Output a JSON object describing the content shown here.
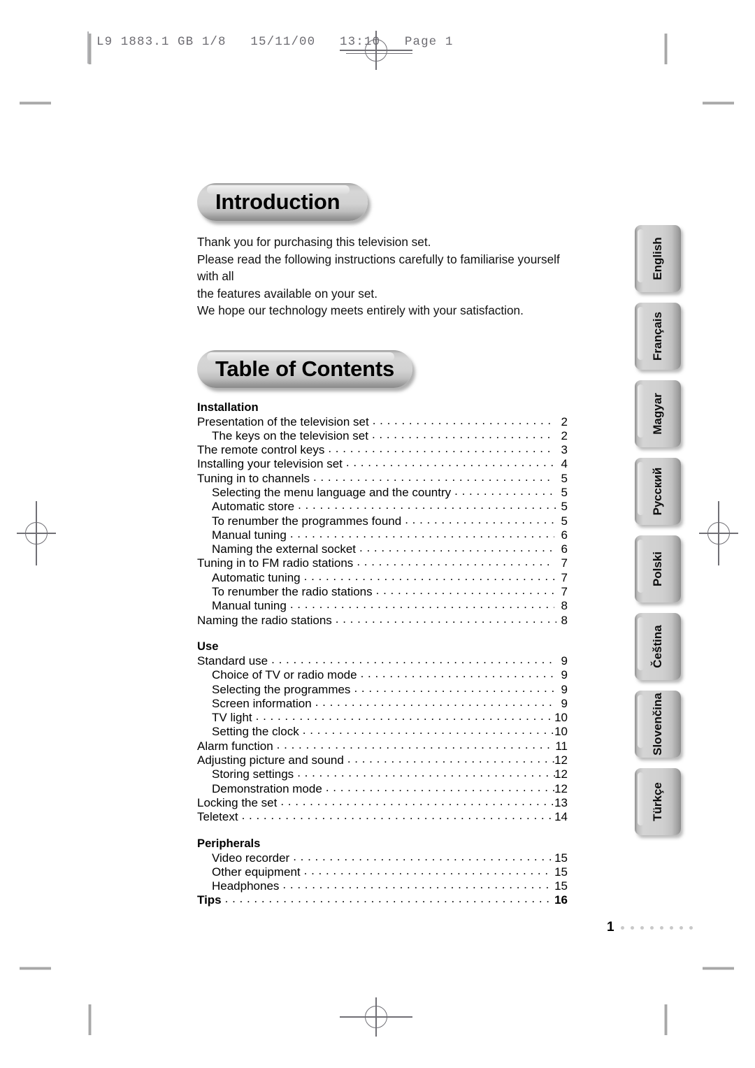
{
  "print_header": {
    "text": "L9 1883.1 GB 1/8   15/11/00   13:10   Page 1"
  },
  "banners": {
    "introduction": "Introduction",
    "table_of_contents": "Table of Contents"
  },
  "intro": {
    "lines": [
      "Thank you for purchasing this television set.",
      "Please read the following instructions carefully to familiarise yourself with all",
      "the features available on your set.",
      "We hope our technology meets entirely with your satisfaction."
    ]
  },
  "toc": {
    "sections": [
      {
        "title": "Installation",
        "entries": [
          {
            "label": "Presentation of the television set",
            "page": "2",
            "level": 1,
            "bold": false,
            "tight": false
          },
          {
            "label": "The keys on the television set",
            "page": "2",
            "level": 2,
            "bold": false,
            "tight": false
          },
          {
            "label": "The remote control keys",
            "page": "3",
            "level": 1,
            "bold": false,
            "tight": false
          },
          {
            "label": "Installing your television set",
            "page": "4",
            "level": 1,
            "bold": false,
            "tight": false
          },
          {
            "label": "Tuning in to channels",
            "page": "5",
            "level": 1,
            "bold": false,
            "tight": false
          },
          {
            "label": "Selecting the menu language and the country",
            "page": "5",
            "level": 2,
            "bold": false,
            "tight": true
          },
          {
            "label": "Automatic store",
            "page": "5",
            "level": 2,
            "bold": false,
            "tight": true
          },
          {
            "label": "To renumber the programmes found",
            "page": "5",
            "level": 2,
            "bold": false,
            "tight": false
          },
          {
            "label": "Manual tuning",
            "page": "6",
            "level": 2,
            "bold": false,
            "tight": false
          },
          {
            "label": "Naming the external socket",
            "page": "6",
            "level": 2,
            "bold": false,
            "tight": false
          },
          {
            "label": "Tuning in to FM radio stations",
            "page": "7",
            "level": 1,
            "bold": false,
            "tight": false
          },
          {
            "label": "Automatic tuning",
            "page": "7",
            "level": 2,
            "bold": false,
            "tight": true
          },
          {
            "label": "To renumber the radio stations",
            "page": "7",
            "level": 2,
            "bold": false,
            "tight": false
          },
          {
            "label": "Manual tuning",
            "page": "8",
            "level": 2,
            "bold": false,
            "tight": false
          },
          {
            "label": "Naming the radio stations",
            "page": "8",
            "level": 1,
            "bold": false,
            "tight": true
          }
        ]
      },
      {
        "title": "Use",
        "entries": [
          {
            "label": "Standard use",
            "page": "9",
            "level": 1,
            "bold": false,
            "tight": false
          },
          {
            "label": "Choice of TV or radio mode",
            "page": "9",
            "level": 2,
            "bold": false,
            "tight": true
          },
          {
            "label": "Selecting the programmes",
            "page": "9",
            "level": 2,
            "bold": false,
            "tight": true
          },
          {
            "label": "Screen information",
            "page": "9",
            "level": 2,
            "bold": false,
            "tight": true
          },
          {
            "label": "TV light",
            "page": "10",
            "level": 2,
            "bold": false,
            "tight": true
          },
          {
            "label": "Setting the clock",
            "page": "10",
            "level": 2,
            "bold": false,
            "tight": true
          },
          {
            "label": "Alarm function",
            "page": "11",
            "level": 1,
            "bold": false,
            "tight": false
          },
          {
            "label": "Adjusting picture and sound",
            "page": "12",
            "level": 1,
            "bold": false,
            "tight": true
          },
          {
            "label": "Storing settings",
            "page": "12",
            "level": 2,
            "bold": false,
            "tight": true
          },
          {
            "label": "Demonstration mode",
            "page": "12",
            "level": 2,
            "bold": false,
            "tight": true
          },
          {
            "label": "Locking the set",
            "page": "13",
            "level": 1,
            "bold": false,
            "tight": true
          },
          {
            "label": "Teletext",
            "page": "14",
            "level": 1,
            "bold": false,
            "tight": false
          }
        ]
      },
      {
        "title": "Peripherals",
        "entries": [
          {
            "label": "Video recorder",
            "page": "15",
            "level": 2,
            "bold": false,
            "tight": false
          },
          {
            "label": "Other equipment",
            "page": "15",
            "level": 2,
            "bold": false,
            "tight": false
          },
          {
            "label": "Headphones",
            "page": "15",
            "level": 2,
            "bold": false,
            "tight": false
          },
          {
            "label": "Tips",
            "page": "16",
            "level": 1,
            "bold": true,
            "tight": false
          }
        ]
      }
    ]
  },
  "language_tabs": [
    {
      "label": "English"
    },
    {
      "label": "Français"
    },
    {
      "label": "Magyar"
    },
    {
      "label": "Русский"
    },
    {
      "label": "Polski"
    },
    {
      "label": "Čeština"
    },
    {
      "label": "Slovenčina"
    },
    {
      "label": "Türkçe"
    }
  ],
  "footer": {
    "page_number": "1",
    "dot_count": 8
  }
}
